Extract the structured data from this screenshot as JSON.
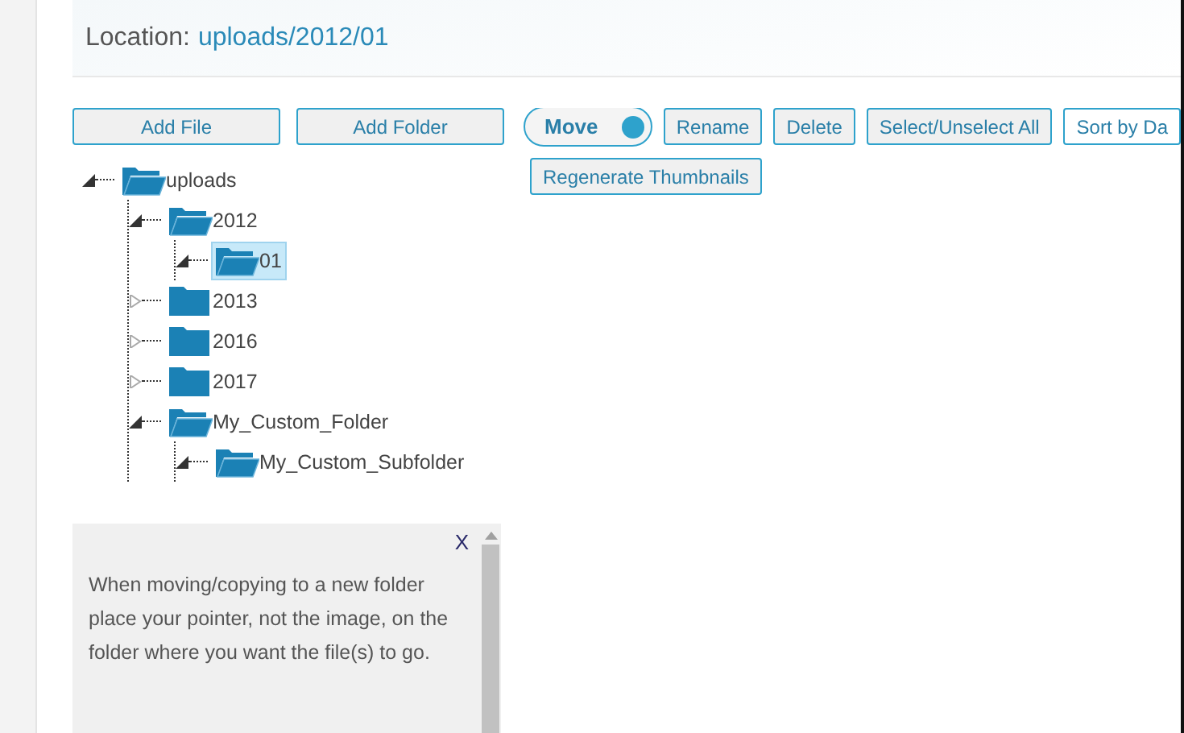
{
  "location": {
    "label": "Location:",
    "path": "uploads/2012/01"
  },
  "left_buttons": [
    "Add File",
    "Add Folder"
  ],
  "move_toggle": {
    "label": "Move",
    "on": true
  },
  "buttons": [
    "Rename",
    "Delete",
    "Select/Unselect All",
    "Sort by Da"
  ],
  "second_row_buttons": [
    "Regenerate Thumbnails"
  ],
  "tree": [
    {
      "label": "uploads",
      "expanded": true,
      "selected": false,
      "children": [
        {
          "label": "2012",
          "expanded": true,
          "selected": false,
          "children": [
            {
              "label": "01",
              "expanded": true,
              "selected": true
            }
          ]
        },
        {
          "label": "2013",
          "expanded": false,
          "selected": false
        },
        {
          "label": "2016",
          "expanded": false,
          "selected": false
        },
        {
          "label": "2017",
          "expanded": false,
          "selected": false
        },
        {
          "label": "My_Custom_Folder",
          "expanded": true,
          "selected": false,
          "children": [
            {
              "label": "My_Custom_Subfolder",
              "expanded": true,
              "selected": false
            }
          ]
        }
      ]
    }
  ],
  "tip": {
    "close": "X",
    "text": "When moving/copying to a new folder place your pointer, not the image, on the folder where you want the file(s) to go."
  }
}
